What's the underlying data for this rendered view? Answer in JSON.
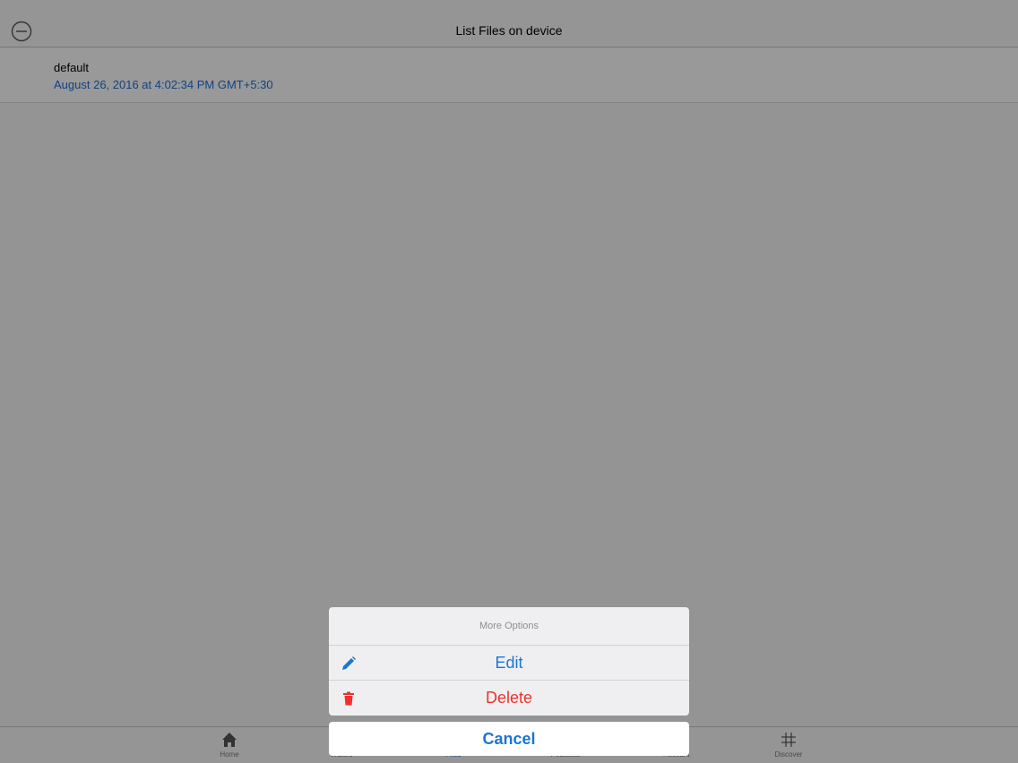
{
  "navbar": {
    "title": "List Files on device"
  },
  "files": [
    {
      "name": "default",
      "date": "August 26, 2016 at 4:02:34 PM GMT+5:30"
    }
  ],
  "tabbar": {
    "tabs": [
      {
        "label": "Home",
        "icon": "home-icon"
      },
      {
        "label": "Wizard",
        "icon": "wizard-icon"
      },
      {
        "label": "Files",
        "icon": "files-icon"
      },
      {
        "label": "Podcasts",
        "icon": "podcasts-icon"
      },
      {
        "label": "Account",
        "icon": "account-icon"
      },
      {
        "label": "Discover",
        "icon": "hashtag-icon"
      }
    ]
  },
  "action_sheet": {
    "title": "More Options",
    "edit_label": "Edit",
    "delete_label": "Delete",
    "cancel_label": "Cancel"
  },
  "colors": {
    "accent": "#1a76d2",
    "destructive": "#f0302c",
    "date_text": "#1e6fd8"
  }
}
